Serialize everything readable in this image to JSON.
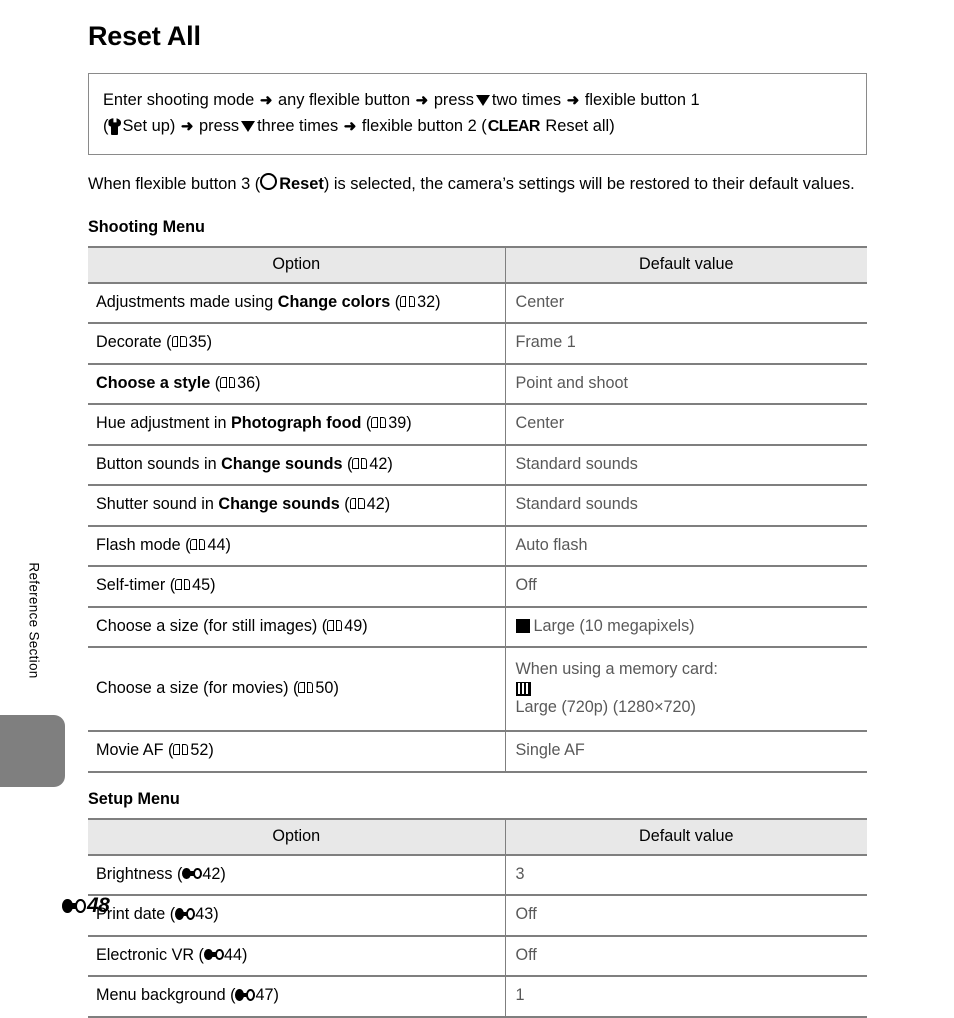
{
  "sidebar": {
    "vertical_label": "Reference Section",
    "tab_color": "#7f7f7f"
  },
  "page": {
    "title": "Reset All",
    "footer_page": "48",
    "footer_marker": "E"
  },
  "procedure_box": {
    "line1_part1": "Enter shooting mode",
    "line1_part2": "any flexible button",
    "line1_part3": "press",
    "line1_part4": "two times",
    "line1_part5": "flexible button 1",
    "line2_part1": "(",
    "line2_setup": "Set up)",
    "line2_part2": "press",
    "line2_part3": "three times",
    "line2_part4": "flexible button 2 (",
    "line2_clear": "CLEAR",
    "line2_part5": "Reset all)",
    "arrow_glyph": "➜"
  },
  "intro": {
    "part1": "When flexible button 3 (",
    "reset_bold": "Reset",
    "part2": ") is selected, the camera’s settings will be restored to their default values."
  },
  "shooting_menu": {
    "heading": "Shooting Menu",
    "columns": [
      "Option",
      "Default value"
    ],
    "rows": [
      {
        "option_pre": "Adjustments made using ",
        "option_bold": "Change colors",
        "option_post": " (",
        "ref": "32",
        "value": "Center"
      },
      {
        "option_pre": "Decorate (",
        "option_bold": "",
        "option_post": "",
        "ref": "35",
        "value": "Frame 1"
      },
      {
        "option_pre": "",
        "option_bold": "Choose a style",
        "option_post": " (",
        "ref": "36",
        "value": "Point and shoot"
      },
      {
        "option_pre": "Hue adjustment in ",
        "option_bold": "Photograph food",
        "option_post": " (",
        "ref": "39",
        "value": "Center"
      },
      {
        "option_pre": "Button sounds in ",
        "option_bold": "Change sounds",
        "option_post": " (",
        "ref": "42",
        "value": "Standard sounds"
      },
      {
        "option_pre": "Shutter sound in ",
        "option_bold": "Change sounds",
        "option_post": " (",
        "ref": "42",
        "value": "Standard sounds"
      },
      {
        "option_pre": "Flash mode (",
        "option_bold": "",
        "option_post": "",
        "ref": "44",
        "value": "Auto flash"
      },
      {
        "option_pre": "Self-timer (",
        "option_bold": "",
        "option_post": "",
        "ref": "45",
        "value": "Off"
      },
      {
        "option_pre": "Choose a size (for still images) (",
        "option_bold": "",
        "option_post": "",
        "ref": "49",
        "value": "Large (10 megapixels)"
      },
      {
        "option_pre": "Choose a size (for movies) (",
        "option_bold": "",
        "option_post": "",
        "ref": "50",
        "value_line1": "When using a memory card:",
        "value_line2": "Large (720p) (1280×720)"
      },
      {
        "option_pre": "Movie AF (",
        "option_bold": "",
        "option_post": "",
        "ref": "52",
        "value": "Single AF"
      }
    ]
  },
  "setup_menu": {
    "heading": "Setup Menu",
    "columns": [
      "Option",
      "Default value"
    ],
    "rows": [
      {
        "option": "Brightness (",
        "ref": "42",
        "value": "3"
      },
      {
        "option": "Print date (",
        "ref": "43",
        "value": "Off"
      },
      {
        "option": "Electronic VR (",
        "ref": "44",
        "value": "Off"
      },
      {
        "option": "Menu background (",
        "ref": "47",
        "value": "1"
      }
    ]
  }
}
